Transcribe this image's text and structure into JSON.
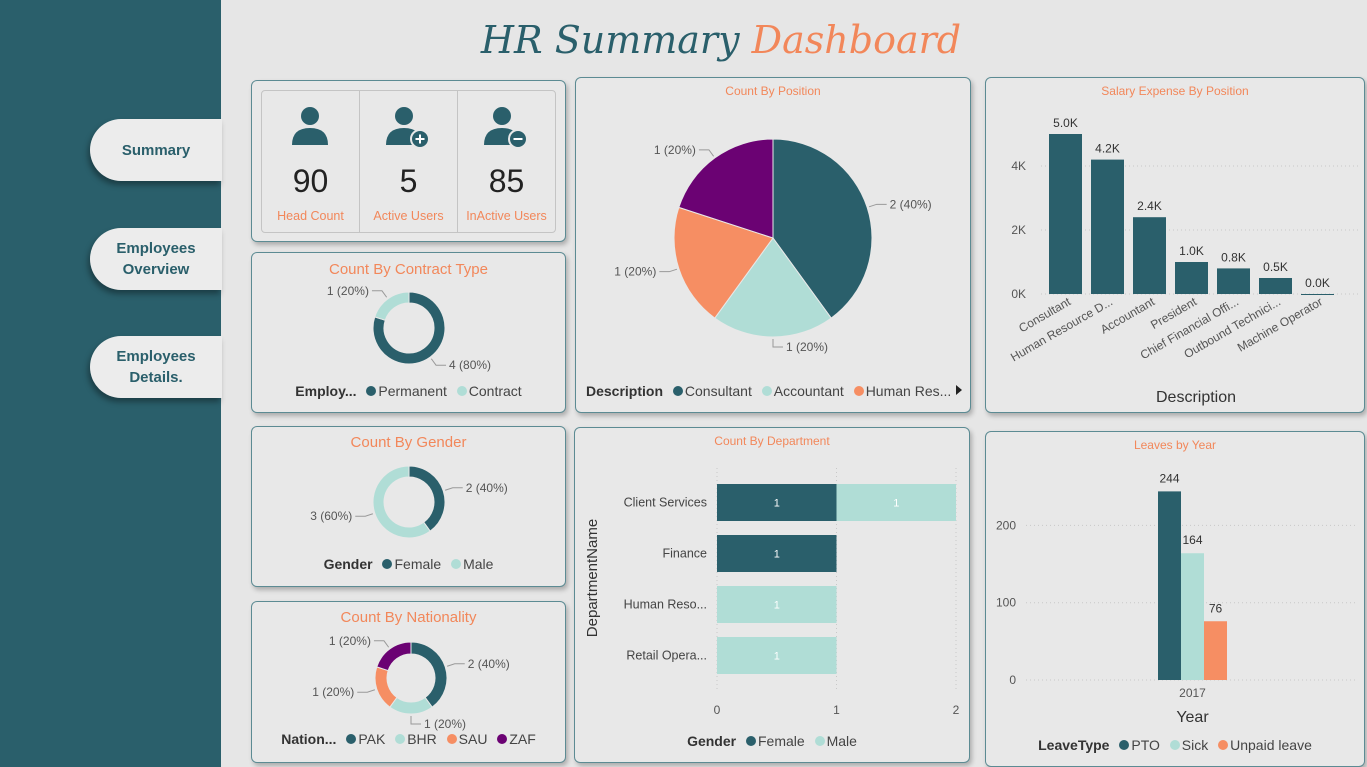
{
  "title": {
    "part1": "HR Summary",
    "part2": "Dashboard"
  },
  "nav": {
    "summary": "Summary",
    "overview_line1": "Employees",
    "overview_line2": "Overview",
    "details": "Employees Details."
  },
  "colors": {
    "teal": "#2a5f6b",
    "mint": "#b0ddd6",
    "orange": "#f68e63",
    "purple": "#6b0273",
    "accent": "#f2875a"
  },
  "kpis": [
    {
      "icon": "user-icon",
      "value": "90",
      "label": "Head Count"
    },
    {
      "icon": "user-add-icon",
      "value": "5",
      "label": "Active Users"
    },
    {
      "icon": "user-remove-icon",
      "value": "85",
      "label": "InActive Users"
    }
  ],
  "contract": {
    "title": "Count By Contract Type",
    "legend_title": "Employ...",
    "legend": [
      "Permanent",
      "Contract"
    ],
    "labels": [
      "4 (80%)",
      "1 (20%)"
    ]
  },
  "gender": {
    "title": "Count By Gender",
    "legend_title": "Gender",
    "legend": [
      "Female",
      "Male"
    ],
    "labels": [
      "2 (40%)",
      "3 (60%)"
    ]
  },
  "nationality": {
    "title": "Count By Nationality",
    "legend_title": "Nation...",
    "legend": [
      "PAK",
      "BHR",
      "SAU",
      "ZAF"
    ],
    "labels": [
      "2 (40%)",
      "1 (20%)",
      "1 (20%)"
    ]
  },
  "position": {
    "title": "Count By Position",
    "legend_title": "Description",
    "legend": [
      "Consultant",
      "Accountant",
      "Human Res..."
    ],
    "labels": [
      "2 (40%)",
      "1 (20%)",
      "1 (20%)",
      "1 (20%)"
    ]
  },
  "salary": {
    "title": "Salary Expense By Position"
  },
  "department": {
    "title": "Count By Department",
    "legend_title": "Gender",
    "legend": [
      "Female",
      "Male"
    ]
  },
  "leaves": {
    "title": "Leaves by Year",
    "legend_title": "LeaveType",
    "legend": [
      "PTO",
      "Sick",
      "Unpaid leave"
    ]
  },
  "chart_data": [
    {
      "type": "pie",
      "title": "Count By Contract Type",
      "categories": [
        "Permanent",
        "Contract"
      ],
      "values": [
        4,
        1
      ],
      "colors": [
        "#2a5f6b",
        "#b0ddd6"
      ],
      "labels": [
        "4 (80%)",
        "1 (20%)"
      ]
    },
    {
      "type": "pie",
      "title": "Count By Gender",
      "categories": [
        "Female",
        "Male"
      ],
      "values": [
        2,
        3
      ],
      "colors": [
        "#2a5f6b",
        "#b0ddd6"
      ],
      "labels": [
        "2 (40%)",
        "3 (60%)"
      ]
    },
    {
      "type": "pie",
      "title": "Count By Nationality",
      "categories": [
        "PAK",
        "BHR",
        "SAU",
        "ZAF"
      ],
      "values": [
        2,
        1,
        1,
        1
      ],
      "colors": [
        "#2a5f6b",
        "#b0ddd6",
        "#f68e63",
        "#6b0273"
      ],
      "labels": [
        "2 (40%)",
        "1 (20%)",
        "1 (20%)",
        "1 (20%)"
      ]
    },
    {
      "type": "pie",
      "title": "Count By Position",
      "categories": [
        "Consultant",
        "Accountant",
        "Human Res...",
        ""
      ],
      "values": [
        2,
        1,
        1,
        1
      ],
      "colors": [
        "#2a5f6b",
        "#b0ddd6",
        "#f68e63",
        "#6b0273"
      ],
      "labels": [
        "2 (40%)",
        "1 (20%)",
        "1 (20%)",
        "1 (20%)"
      ]
    },
    {
      "type": "bar",
      "title": "Salary Expense By Position",
      "xlabel": "Description",
      "categories": [
        "Consultant",
        "Human Resource D...",
        "Accountant",
        "President",
        "Chief Financial Offi...",
        "Outbound Technici...",
        "Machine Operator"
      ],
      "values": [
        5.0,
        4.2,
        2.4,
        1.0,
        0.8,
        0.5,
        0.0
      ],
      "value_labels": [
        "5.0K",
        "4.2K",
        "2.4K",
        "1.0K",
        "0.8K",
        "0.5K",
        "0.0K"
      ],
      "yticks": [
        "0K",
        "2K",
        "4K"
      ],
      "ylim": [
        0,
        5.4
      ]
    },
    {
      "type": "bar",
      "orientation": "horizontal",
      "title": "Count By Department",
      "ylabel": "DepartmentName",
      "categories": [
        "Client Services",
        "Finance",
        "Human Reso...",
        "Retail Opera..."
      ],
      "series": [
        {
          "name": "Female",
          "values": [
            1,
            1,
            0,
            0
          ]
        },
        {
          "name": "Male",
          "values": [
            1,
            0,
            1,
            1
          ]
        }
      ],
      "xticks": [
        "0",
        "1",
        "2"
      ],
      "xlim": [
        0,
        2
      ]
    },
    {
      "type": "bar",
      "title": "Leaves by Year",
      "xlabel": "Year",
      "categories": [
        "2017"
      ],
      "series": [
        {
          "name": "PTO",
          "values": [
            244
          ]
        },
        {
          "name": "Sick",
          "values": [
            164
          ]
        },
        {
          "name": "Unpaid leave",
          "values": [
            76
          ]
        }
      ],
      "yticks": [
        "0",
        "100",
        "200"
      ],
      "ylim": [
        0,
        250
      ]
    }
  ]
}
